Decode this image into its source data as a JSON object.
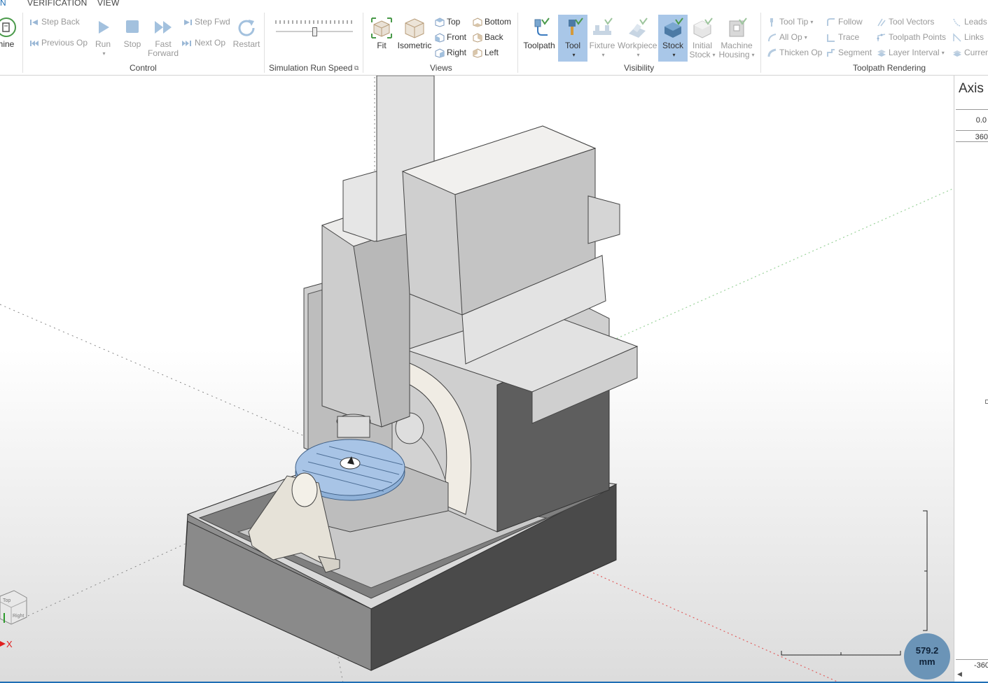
{
  "tabs": [
    {
      "label": "N",
      "active": true
    },
    {
      "label": "VERIFICATION",
      "active": false
    },
    {
      "label": "VIEW",
      "active": false
    }
  ],
  "machine_button": {
    "label": "hine"
  },
  "control": {
    "group_label": "Control",
    "step_back": "Step Back",
    "previous_op": "Previous Op",
    "run": "Run",
    "stop": "Stop",
    "fast_forward_l1": "Fast",
    "fast_forward_l2": "Forward",
    "step_fwd": "Step Fwd",
    "next_op": "Next Op",
    "restart": "Restart"
  },
  "speed": {
    "group_label": "Simulation Run Speed",
    "value_percent": 50
  },
  "views": {
    "group_label": "Views",
    "fit": "Fit",
    "isometric": "Isometric",
    "top": "Top",
    "front": "Front",
    "right": "Right",
    "bottom": "Bottom",
    "back": "Back",
    "left": "Left"
  },
  "visibility": {
    "group_label": "Visibility",
    "toolpath": "Toolpath",
    "tool": "Tool",
    "fixture": "Fixture",
    "workpiece": "Workpiece",
    "stock": "Stock",
    "initial_stock_l1": "Initial",
    "initial_stock_l2": "Stock",
    "machine_housing_l1": "Machine",
    "machine_housing_l2": "Housing"
  },
  "rendering": {
    "group_label": "Toolpath Rendering",
    "tool_tip": "Tool Tip",
    "all_op": "All Op",
    "thicken_op": "Thicken Op",
    "follow": "Follow",
    "trace": "Trace",
    "segment": "Segment",
    "tool_vectors": "Tool Vectors",
    "toolpath_points": "Toolpath Points",
    "layer_interval": "Layer Interval",
    "leads": "Leads",
    "links": "Links",
    "current": "Curren"
  },
  "axis_panel": {
    "title": "Axis C",
    "value1": "0.0",
    "value2": "360",
    "value3": "-360"
  },
  "view_cube": {
    "face_top": "Top",
    "face_right": "Right",
    "axis_x": "X"
  },
  "scale": {
    "value": "579.2",
    "unit": "mm"
  },
  "colors": {
    "accent": "#1f6fb5",
    "selected": "#a9c7e8",
    "table": "#a8c4e6",
    "badge": "#6b94b7"
  }
}
